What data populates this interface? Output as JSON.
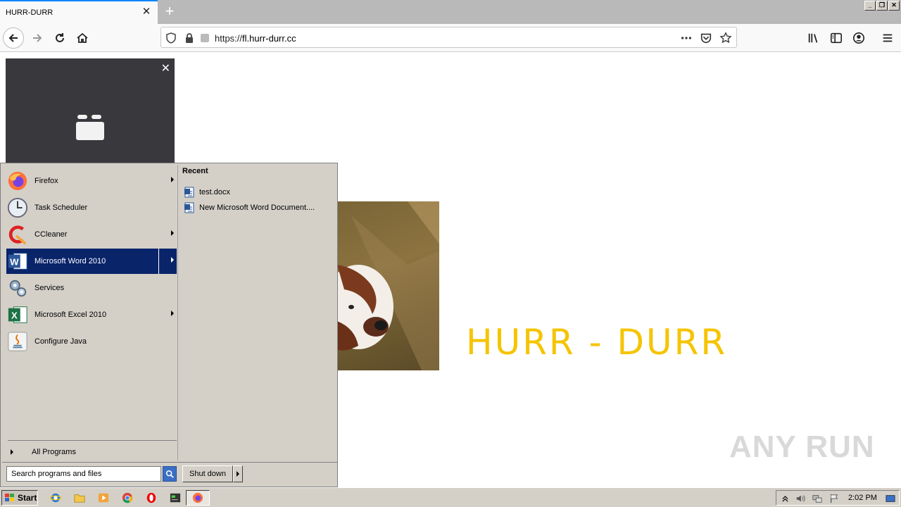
{
  "browser": {
    "tab_title": "HURR-DURR",
    "url_scheme": "https://",
    "url_host": "fl.hurr-durr.cc",
    "icons": {
      "back": "arrow-left-icon",
      "forward": "arrow-right-icon",
      "reload": "reload-icon",
      "home": "home-icon",
      "tracking": "shield-icon",
      "lock": "lock-icon",
      "more": "ellipsis-icon",
      "pocket": "pocket-icon",
      "bookmark": "star-icon",
      "library": "library-icon",
      "sidebar": "sidebar-icon",
      "account": "account-icon",
      "menu": "hamburger-icon"
    }
  },
  "page": {
    "heading": "HURR - DURR",
    "heading_color": "#f5c400",
    "watermark": "ANY RUN"
  },
  "start_menu": {
    "programs": [
      {
        "label": "Firefox",
        "icon": "firefox-icon",
        "has_submenu": true,
        "selected": false
      },
      {
        "label": "Task Scheduler",
        "icon": "clock-icon",
        "has_submenu": false,
        "selected": false
      },
      {
        "label": "CCleaner",
        "icon": "ccleaner-icon",
        "has_submenu": true,
        "selected": false
      },
      {
        "label": "Microsoft Word 2010",
        "icon": "word-icon",
        "has_submenu": true,
        "selected": true
      },
      {
        "label": "Services",
        "icon": "gears-icon",
        "has_submenu": false,
        "selected": false
      },
      {
        "label": "Microsoft Excel 2010",
        "icon": "excel-icon",
        "has_submenu": true,
        "selected": false
      },
      {
        "label": "Configure Java",
        "icon": "java-icon",
        "has_submenu": false,
        "selected": false
      }
    ],
    "all_programs": "All Programs",
    "recent_heading": "Recent",
    "recent_items": [
      "test.docx",
      "New Microsoft Word Document...."
    ],
    "search_placeholder": "Search programs and files",
    "shutdown_label": "Shut down"
  },
  "taskbar": {
    "start_label": "Start",
    "clock": "2:02 PM"
  }
}
